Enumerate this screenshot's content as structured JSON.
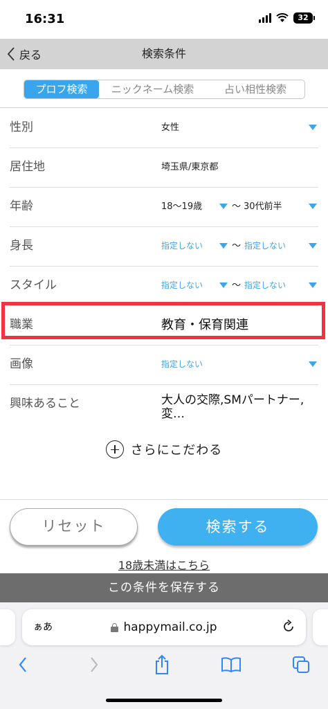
{
  "status": {
    "time": "16:31",
    "battery": "32"
  },
  "header": {
    "back_label": "戻る",
    "title": "検索条件"
  },
  "tabs": [
    {
      "label": "プロフ検索",
      "active": true
    },
    {
      "label": "ニックネーム検索",
      "active": false
    },
    {
      "label": "占い相性検索",
      "active": false
    }
  ],
  "fields": {
    "gender": {
      "label": "性別",
      "value": "女性"
    },
    "residence": {
      "label": "居住地",
      "value": "埼玉県/東京都"
    },
    "age": {
      "label": "年齢",
      "from": "18〜19歳",
      "sep": "〜",
      "to": "30代前半"
    },
    "height": {
      "label": "身長",
      "from": "指定しない",
      "sep": "〜",
      "to": "指定しない"
    },
    "style": {
      "label": "スタイル",
      "from": "指定しない",
      "sep": "〜",
      "to": "指定しない"
    },
    "job": {
      "label": "職業",
      "value": "教育・保育関連"
    },
    "image": {
      "label": "画像",
      "value": "指定しない"
    },
    "interest": {
      "label": "興味あること",
      "value": "大人の交際,SMパートナー,変…"
    }
  },
  "more_label": "さらにこだわる",
  "actions": {
    "reset": "リセット",
    "search": "検索する"
  },
  "under18_link": "18歳未満はこちら",
  "save_label": "この条件を保存する",
  "browser": {
    "aa": "ぁあ",
    "url": "happymail.co.jp"
  },
  "colors": {
    "accent": "#38a5ec",
    "highlight": "#ef3340",
    "header_bg": "#d3d3d3",
    "save_bar": "#6d6d6d"
  }
}
